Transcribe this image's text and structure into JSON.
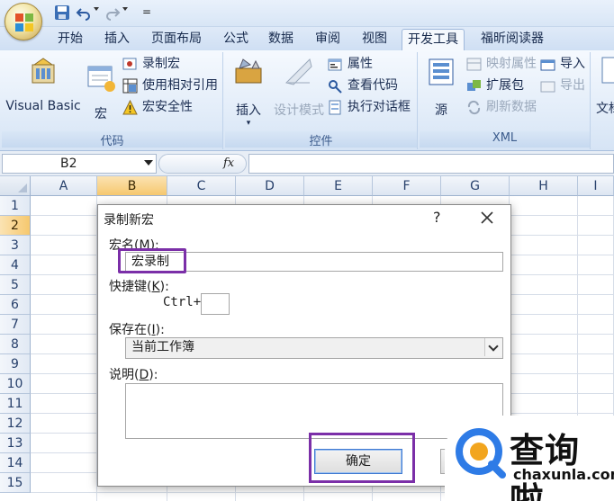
{
  "qat": {
    "save_icon": "save-icon",
    "undo_icon": "undo-icon",
    "redo_icon": "redo-icon"
  },
  "tabs": [
    {
      "label": "开始"
    },
    {
      "label": "插入"
    },
    {
      "label": "页面布局"
    },
    {
      "label": "公式"
    },
    {
      "label": "数据"
    },
    {
      "label": "审阅"
    },
    {
      "label": "视图"
    },
    {
      "label": "开发工具",
      "active": true
    },
    {
      "label": "福昕阅读器"
    }
  ],
  "ribbon": {
    "code_group": {
      "label": "代码",
      "visual_basic": "Visual Basic",
      "macros": "宏",
      "record_macro": "录制宏",
      "relative_ref": "使用相对引用",
      "macro_security": "宏安全性"
    },
    "controls_group": {
      "label": "控件",
      "insert": "插入",
      "design_mode": "设计模式",
      "properties": "属性",
      "view_code": "查看代码",
      "run_dialog": "执行对话框"
    },
    "xml_group": {
      "label": "XML",
      "source": "源",
      "map_properties": "映射属性",
      "expansion_packs": "扩展包",
      "refresh_data": "刷新数据",
      "import": "导入",
      "export": "导出"
    },
    "document_panel_partial": "文档"
  },
  "formula_bar": {
    "name_box": "B2",
    "fx": "fx",
    "formula": ""
  },
  "grid": {
    "columns": [
      "A",
      "B",
      "C",
      "D",
      "E",
      "F",
      "G",
      "H",
      "I"
    ],
    "rows": [
      "1",
      "2",
      "3",
      "4",
      "5",
      "6",
      "7",
      "8",
      "9",
      "10",
      "11",
      "12",
      "13",
      "14",
      "15"
    ],
    "selected_column": "B",
    "selected_row": "2"
  },
  "dialog": {
    "title": "录制新宏",
    "help": "?",
    "macro_name_label_prefix": "宏名(",
    "macro_name_label_key": "M",
    "macro_name_label_suffix": "):",
    "macro_name_value": "宏录制",
    "shortcut_label_prefix": "快捷键(",
    "shortcut_label_key": "K",
    "shortcut_label_suffix": "):",
    "ctrl_prefix": "Ctrl+",
    "shortcut_value": "",
    "store_in_label_prefix": "保存在(",
    "store_in_label_key": "I",
    "store_in_label_suffix": "):",
    "store_in_value": "当前工作簿",
    "description_label_prefix": "说明(",
    "description_label_key": "D",
    "description_label_suffix": "):",
    "description_value": "",
    "ok_button": "确定",
    "cancel_button_partial": "取"
  },
  "watermark": {
    "text": "查询啦",
    "url": "chaxunla.com"
  },
  "colors": {
    "highlight": "#7b2fa8",
    "selected_header": "#f6c86e",
    "ribbon_text": "#1c2e52"
  }
}
